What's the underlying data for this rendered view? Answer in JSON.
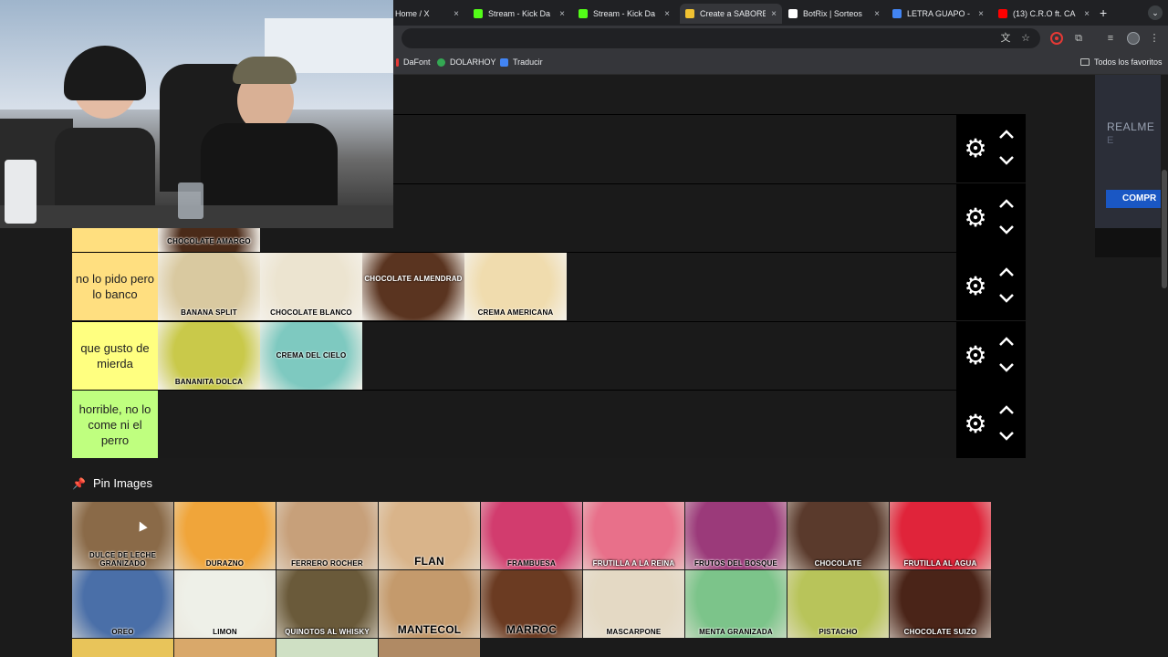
{
  "browser": {
    "tabs": [
      {
        "label": "Home / X",
        "favicon_color": "#000000",
        "active": false
      },
      {
        "label": "Stream - Kick Da",
        "favicon_color": "#53fc18",
        "active": false
      },
      {
        "label": "Stream - Kick Da",
        "favicon_color": "#53fc18",
        "active": false
      },
      {
        "label": "Create a SABORE",
        "favicon_color": "#f1c232",
        "active": true
      },
      {
        "label": "BotRix | Sorteos",
        "favicon_color": "#ffffff",
        "active": false
      },
      {
        "label": "LETRA GUAPO - L",
        "favicon_color": "#4285f4",
        "active": false
      },
      {
        "label": "(13) C.R.O ft. CA",
        "favicon_color": "#ff0000",
        "active": false
      }
    ],
    "tab_close": "×",
    "new_tab": "+",
    "bookmarks": [
      {
        "label": "DaFont",
        "color": "#e53935"
      },
      {
        "label": "DOLARHOY",
        "color": "#34a853"
      },
      {
        "label": "Traducir",
        "color": "#4285f4"
      }
    ],
    "all_bookmarks": "Todos los favoritos"
  },
  "tiers": [
    {
      "label": "",
      "color": "#ffbf7f",
      "items": []
    },
    {
      "label": "",
      "color": "#ffdf7f",
      "items": [
        {
          "name": "CHOCOLATE AMARGO",
          "bg": "#4a2a18"
        }
      ]
    },
    {
      "label": "no lo pido pero lo banco",
      "color": "#ffdf80",
      "items": [
        {
          "name": "BANANA SPLIT",
          "bg": "#d9c9a0"
        },
        {
          "name": "CHOCOLATE BLANCO",
          "bg": "#ece4d0"
        },
        {
          "name": "CHOCOLATE ALMENDRAD",
          "bg": "#5a3420"
        },
        {
          "name": "CREMA AMERICANA",
          "bg": "#f0dcae"
        }
      ]
    },
    {
      "label": "que gusto de mierda",
      "color": "#ffff80",
      "items": [
        {
          "name": "BANANITA DOLCA",
          "bg": "#c9c94a"
        },
        {
          "name": "CREMA DEL CIELO",
          "bg": "#7ec9c0"
        }
      ]
    },
    {
      "label": "horrible, no lo come ni el perro",
      "color": "#bfff7f",
      "items": []
    }
  ],
  "controls": {
    "gear": "⚙"
  },
  "pin_section": {
    "title": "Pin Images",
    "icon": "pin-icon",
    "images": [
      {
        "name": "DULCE DE LECHE GRANIZADO",
        "bg": "#8a6a48",
        "style": "dark"
      },
      {
        "name": "DURAZNO",
        "bg": "#f0a53a",
        "style": "dark"
      },
      {
        "name": "FERRERO ROCHER",
        "bg": "#c7a07a",
        "style": "dark"
      },
      {
        "name": "FLAN",
        "bg": "#d9b48a",
        "style": "dark big"
      },
      {
        "name": "FRAMBUESA",
        "bg": "#d23c6e",
        "style": "dark"
      },
      {
        "name": "FRUTILLA A LA REINA",
        "bg": "#e8708a",
        "style": "light"
      },
      {
        "name": "FRUTOS DEL BOSQUE",
        "bg": "#9b3a7a",
        "style": "dark"
      },
      {
        "name": "CHOCOLATE",
        "bg": "#5a3a2c",
        "style": "light"
      },
      {
        "name": "FRUTILLA AL AGUA",
        "bg": "#e0243a",
        "style": "light"
      },
      {
        "name": "OREO",
        "bg": "#4a6fa8",
        "style": "dark"
      },
      {
        "name": "LIMON",
        "bg": "#eef0e8",
        "style": "dark"
      },
      {
        "name": "QUINOTOS AL WHISKY",
        "bg": "#6a5a3a",
        "style": "light"
      },
      {
        "name": "MANTECOL",
        "bg": "#c49a6c",
        "style": "dark big"
      },
      {
        "name": "MARROC",
        "bg": "#6b3b22",
        "style": "dark big"
      },
      {
        "name": "MASCARPONE",
        "bg": "#e4d9c4",
        "style": "dark"
      },
      {
        "name": "MENTA GRANIZADA",
        "bg": "#7cc48a",
        "style": "dark"
      },
      {
        "name": "PISTACHO",
        "bg": "#b8c45a",
        "style": "dark"
      },
      {
        "name": "CHOCOLATE SUIZO",
        "bg": "#4a2418",
        "style": "light"
      }
    ]
  },
  "side_ad": {
    "title": "REALME",
    "sub": "E",
    "button": "COMPR"
  }
}
